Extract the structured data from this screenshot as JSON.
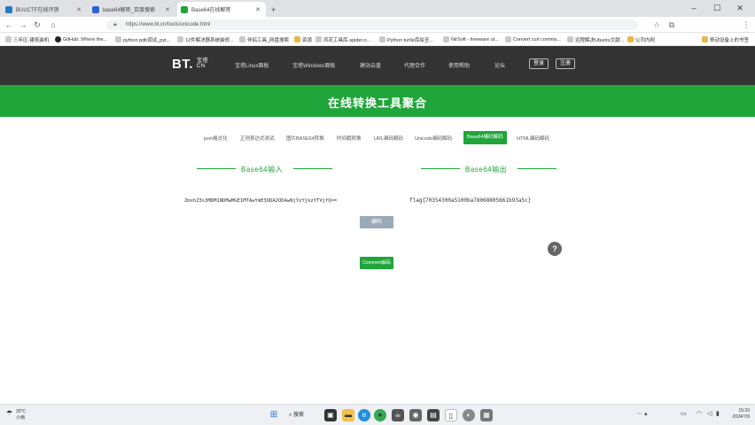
{
  "browser": {
    "tabs": [
      {
        "title": "BUUCTF在线评测"
      },
      {
        "title": "base64解密_百度搜索"
      },
      {
        "title": "Base64在线解密"
      }
    ],
    "new_tab": "+",
    "url": "https://www.bt.cn/tools/unicode.html",
    "bookmarks": [
      "三年区-建筑装机",
      "GitHub: Where the...",
      "python pdb调试_pyt...",
      "12件解决器系统装修...",
      "伴侣工具_网盘搜索",
      "资源",
      "风花工具库-spider.o...",
      "Python turtle库绘至...",
      "NirSoft - freeware ut...",
      "Convert curl comma...",
      "远程解决Ubuntu文献...",
      "公司内网",
      "移动设备上的书签"
    ]
  },
  "site": {
    "logo_main": "BT.",
    "logo_sub": "宝塔 CN",
    "nav": [
      "宝塔Linux面板",
      "宝塔Windows面板",
      "建站云盘",
      "代理合作",
      "使用帮助",
      "论坛"
    ],
    "login": "登录",
    "register": "注册",
    "banner_title": "在线转换工具聚合"
  },
  "tools": {
    "tabs": [
      {
        "label": "json格式化",
        "active": false
      },
      {
        "label": "正则表达式测试",
        "active": false
      },
      {
        "label": "图片BASE64转换",
        "active": false
      },
      {
        "label": "时间戳转换",
        "active": false
      },
      {
        "label": "URL编码解码",
        "active": false
      },
      {
        "label": "Unicode编码解码",
        "active": false
      },
      {
        "label": "Base64编码解码",
        "active": true
      },
      {
        "label": "HTML编码解码",
        "active": false
      }
    ],
    "input_label": "Base64输入",
    "output_label": "Base64输出",
    "input_value": "ZmxhZ3s3MDM1NDMwMGE1MTAwYmE3ODA2ODAwNjYzYjkzYTVjfQ==",
    "output_value": "flag{70354300a5100ba78068805661b93a5c}",
    "convert_button": "编码",
    "comment_button": "Comment解码",
    "help_icon": "help-icon"
  },
  "taskbar": {
    "weather_temp": "30°C",
    "weather_desc": "小雨",
    "search_label": "搜索",
    "time": "15:33",
    "date": "2024/7/9"
  },
  "colors": {
    "accent": "#20a53a",
    "nav_bg": "#333333"
  }
}
